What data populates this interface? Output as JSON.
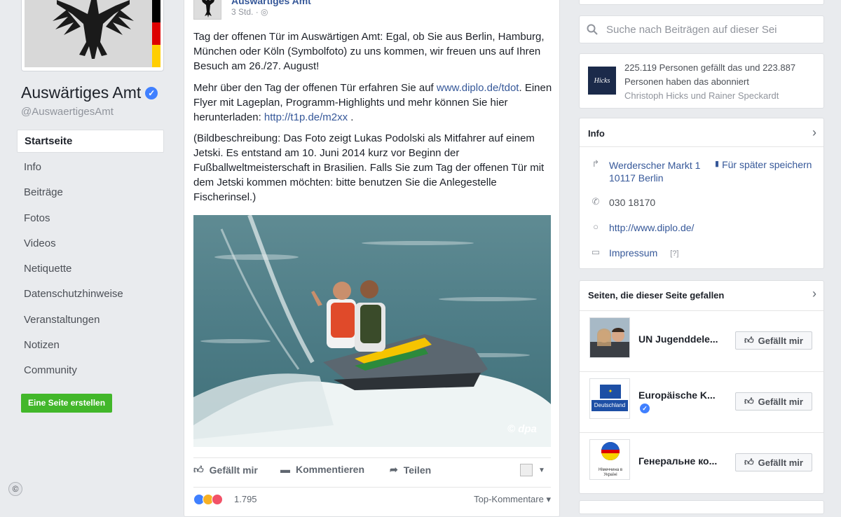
{
  "page": {
    "name": "Auswärtiges Amt",
    "handle": "@AuswaertigesAmt"
  },
  "nav": [
    {
      "label": "Startseite",
      "active": true
    },
    {
      "label": "Info"
    },
    {
      "label": "Beiträge"
    },
    {
      "label": "Fotos"
    },
    {
      "label": "Videos"
    },
    {
      "label": "Netiquette"
    },
    {
      "label": "Datenschutzhinweise"
    },
    {
      "label": "Veranstaltungen"
    },
    {
      "label": "Notizen"
    },
    {
      "label": "Community"
    }
  ],
  "create_page_label": "Eine Seite erstellen",
  "copyright_symbol": "©",
  "post": {
    "author": "Auswärtiges Amt",
    "time": "3 Std. ·",
    "para1": "Tag der offenen Tür im Auswärtigen Amt: Egal, ob Sie aus Berlin, Hamburg, München oder Köln (Symbolfoto) zu uns kommen, wir freuen uns auf Ihren Besuch am 26./27. August!",
    "para2_a": "Mehr über den Tag der offenen Tür erfahren Sie auf ",
    "para2_link1": "www.diplo.de/tdot",
    "para2_b": ". Einen Flyer mit Lageplan, Programm-Highlights und mehr können Sie hier herunterladen: ",
    "para2_link2": "http://t1p.de/m2xx",
    "para2_c": " .",
    "para3": "(Bildbeschreibung: Das Foto zeigt Lukas Podolski als Mitfahrer auf einem Jetski. Es entstand am 10. Juni 2014 kurz vor Beginn der Fußballweltmeisterschaft in Brasilien. Falls Sie zum Tag der offenen Tür mit dem Jetski kommen möchten: bitte benutzen Sie die Anlegestelle Fischerinsel.)",
    "photo_credit": "© dpa",
    "actions": {
      "like": "Gefällt mir",
      "comment": "Kommentieren",
      "share": "Teilen"
    },
    "reaction_count": "1.795",
    "top_comments": "Top-Kommentare ▾"
  },
  "search": {
    "placeholder": "Suche nach Beiträgen auf dieser Sei"
  },
  "likes_card": {
    "line1": "225.119 Personen gefällt das und 223.887",
    "line2": "Personen haben das abonniert",
    "friends": "Christoph Hicks und Rainer Speckardt",
    "thumb_text": "Hicks"
  },
  "info_card": {
    "title": "Info",
    "address1": "Werderscher Markt 1",
    "address2": "10117 Berlin",
    "save_later": "Für später speichern",
    "phone": "030 18170",
    "website": "http://www.diplo.de/",
    "impressum": "Impressum",
    "impressum_hint": "[?]"
  },
  "liked_pages": {
    "title": "Seiten, die dieser Seite gefallen",
    "items": [
      {
        "name": "UN Jugenddele...",
        "button": "Gefällt mir"
      },
      {
        "name": "Europäische K...",
        "button": "Gefällt mir",
        "thumb_text": "Deutschland"
      },
      {
        "name": "Генеральне ко...",
        "button": "Gefällt mir",
        "thumb_text": "Німеччина в Україні"
      }
    ]
  },
  "colors": {
    "accent": "#365899",
    "create_green": "#42b72a",
    "verified": "#4080ff"
  }
}
